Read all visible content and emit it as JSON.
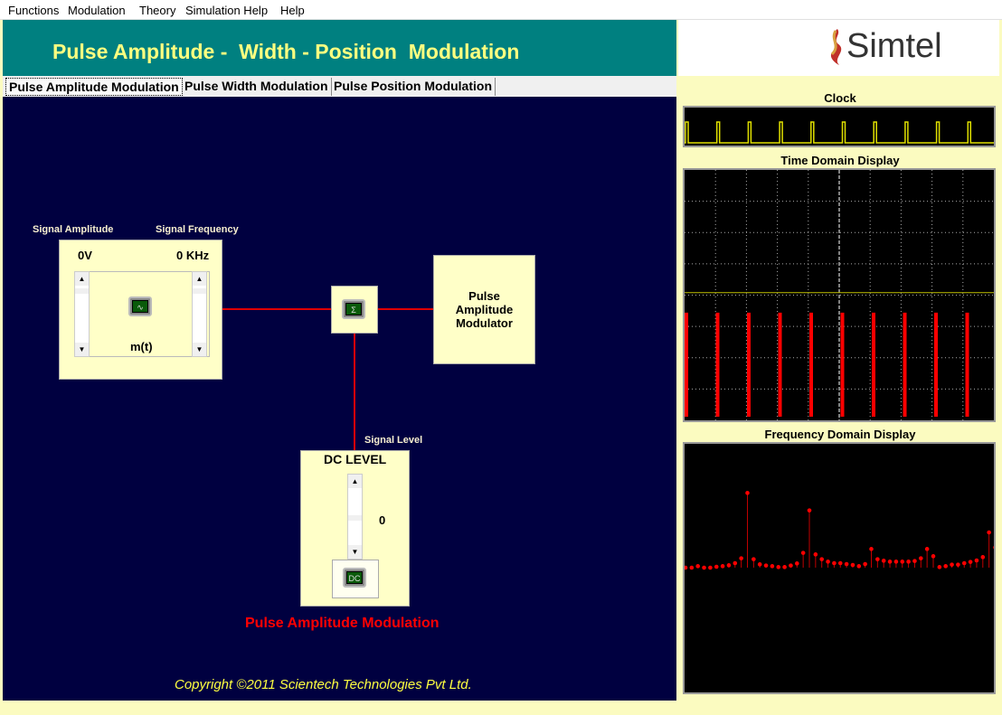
{
  "menu": [
    "Functions",
    "Modulation",
    "Theory",
    "Simulation Help",
    "Help"
  ],
  "header": {
    "title": "Pulse Amplitude -  Width - Position  Modulation"
  },
  "logo": {
    "text": "Simtel"
  },
  "tabs": [
    {
      "label": "Pulse Amplitude Modulation",
      "active": true
    },
    {
      "label": "Pulse Width Modulation"
    },
    {
      "label": "Pulse Position Modulation"
    }
  ],
  "signal": {
    "amp_label": "Signal Amplitude",
    "freq_label": "Signal Frequency",
    "amp_value": "0V",
    "freq_value": "0 KHz",
    "name": "m(t)"
  },
  "sum_icon": "Σ",
  "modulator": {
    "label": "Pulse Amplitude Modulator"
  },
  "dc": {
    "signal_level_label": "Signal Level",
    "title": "DC LEVEL",
    "value": "0",
    "icon_text": "DC"
  },
  "mode_title": "Pulse Amplitude Modulation",
  "copyright": "Copyright ©2011 Scientech Technologies Pvt Ltd.",
  "displays": {
    "clock": "Clock",
    "time": "Time Domain Display",
    "freq": "Frequency Domain Display"
  },
  "colors": {
    "clock": "#e0e000",
    "pulses": "#ff0000",
    "teal": "#008080",
    "navy": "#000040"
  },
  "chart_data": [
    {
      "type": "line",
      "title": "Clock",
      "pulses": 10
    },
    {
      "type": "bar",
      "title": "Time Domain Display",
      "pulses": 10,
      "pulse_level": 0.43,
      "reference_level": 0.51,
      "grid": true
    },
    {
      "type": "stem",
      "title": "Frequency Domain Display",
      "values": [
        0,
        0,
        5,
        0,
        0,
        3,
        5,
        8,
        15,
        31,
        248,
        28,
        11,
        7,
        5,
        2,
        2,
        7,
        14,
        49,
        190,
        44,
        28,
        20,
        15,
        15,
        12,
        9,
        5,
        12,
        62,
        28,
        23,
        20,
        20,
        20,
        20,
        22,
        31,
        62,
        38,
        2,
        5,
        10,
        10,
        15,
        19,
        24,
        35,
        117,
        67
      ]
    }
  ]
}
